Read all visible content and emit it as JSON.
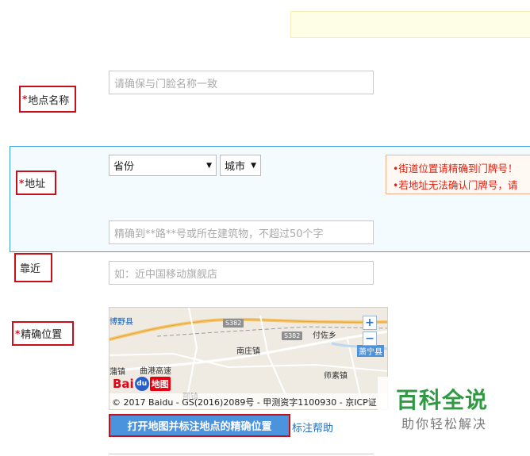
{
  "form": {
    "place_name": {
      "label": "地点名称",
      "required_mark": "*",
      "placeholder": "请确保与门脸名称一致"
    },
    "address": {
      "label": "地址",
      "required_mark": "*",
      "province_select": {
        "selected": "省份"
      },
      "city_select": {
        "selected": "城市"
      },
      "detail_placeholder": "精确到**路**号或所在建筑物，不超过50个字",
      "tips": [
        "•街道位置请精确到门牌号！",
        "•若地址无法确认门牌号，请"
      ]
    },
    "nearby": {
      "label": "靠近",
      "placeholder": "如：近中国移动旗舰店"
    },
    "precise_location": {
      "label": "精确位置",
      "required_mark": "*",
      "map": {
        "places": [
          "博野县",
          "付佐乡",
          "南庄镇",
          "曲港高速",
          "师素镇",
          "蒲镇",
          "萧宁县",
          "邢镇"
        ],
        "road_tags": [
          "S382",
          "S382"
        ],
        "zoom_in": "+",
        "zoom_out": "−",
        "logo_text": "Bai",
        "logo_paw": "du",
        "logo_suffix": "地图",
        "copyright": "© 2017 Baidu - GS(2016)2089号 - 甲测资字1100930 - 京ICP证"
      },
      "open_map_button": "打开地图并标注地点的精确位置",
      "help_link": "标注帮助"
    }
  },
  "watermark": {
    "title": "百科全说",
    "subtitle": "助你轻松解决"
  },
  "colors": {
    "required_red": "#e2131c",
    "highlight_border": "#c8101a",
    "panel_border": "#3c9de0",
    "button_blue": "#4b93dc",
    "link_blue": "#1f6fb8",
    "watermark_green": "#2f9a43"
  }
}
